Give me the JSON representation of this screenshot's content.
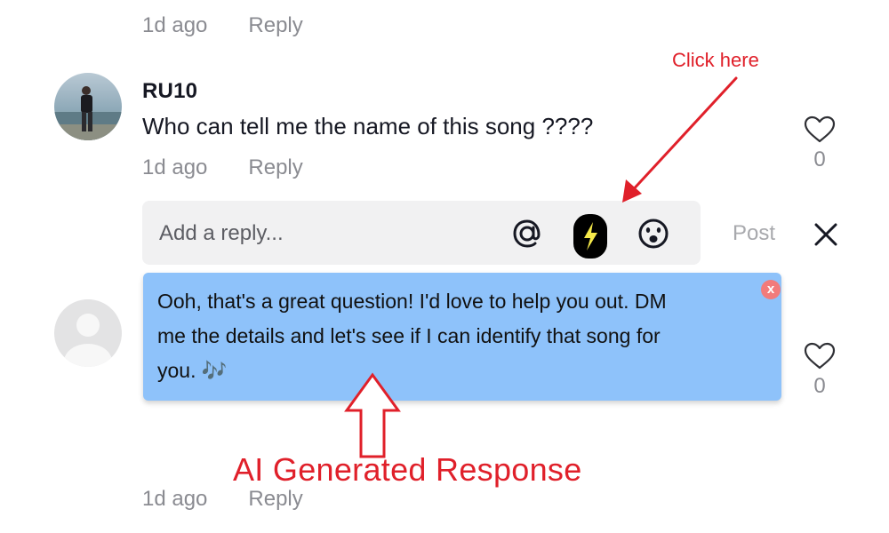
{
  "comments": [
    {
      "time": "1d ago",
      "reply_label": "Reply"
    },
    {
      "username": "RU10",
      "text": "Who can tell me the name of this song ????",
      "time": "1d ago",
      "reply_label": "Reply",
      "like_count": "0"
    },
    {
      "like_count": "0",
      "time": "1d ago",
      "reply_label": "Reply"
    }
  ],
  "reply_box": {
    "placeholder": "Add a reply...",
    "post_label": "Post",
    "icons": [
      "mention-icon",
      "ai-lightning-icon",
      "emoji-icon",
      "close-icon"
    ]
  },
  "ai_suggestion": {
    "line1": "Ooh, that's a great question! I'd love to help you out. DM",
    "line2": "me the details and let's see if I can identify that song for",
    "line3": "you. 🎶",
    "close_label": "x"
  },
  "annotations": {
    "click_here": "Click here",
    "ai_generated": "AI Generated Response",
    "color": "#e0202a"
  },
  "colors": {
    "ai_box": "#8ec2fa",
    "reply_box": "#f1f1f2",
    "lightning_bg": "#000000",
    "lightning_bolt": "#f5e94a",
    "muted_text": "#8a8b91"
  }
}
